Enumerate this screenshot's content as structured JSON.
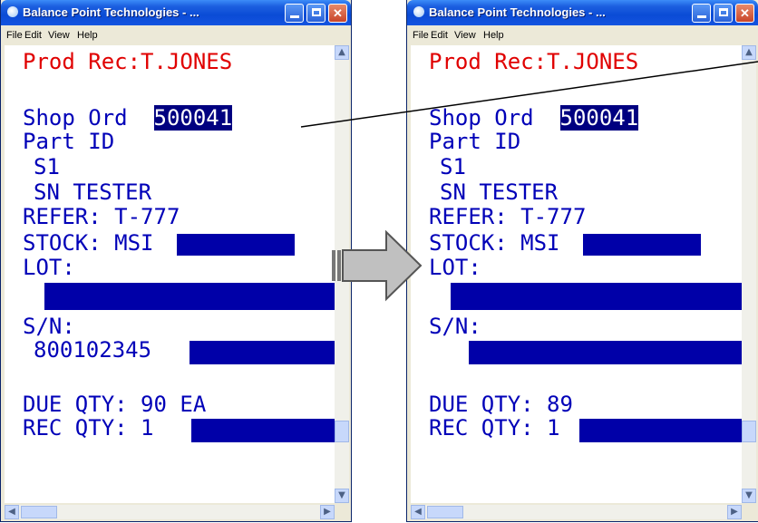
{
  "window_title": "Balance Point Technologies - ...",
  "menu": [
    "File",
    "Edit",
    "View",
    "Help"
  ],
  "before": {
    "header_label": "Prod Rec:",
    "header_user": "T.JONES",
    "shop_ord_label": "Shop Ord",
    "shop_ord_value": "500041",
    "part_id_label": "Part ID",
    "part_id": "S1",
    "part_desc": "SN TESTER",
    "refer": "REFER: T-777",
    "stock": "STOCK: MSI",
    "lot_label": "LOT:",
    "sn_label": "S/N:",
    "sn_value": "800102345",
    "due_qty": "DUE QTY: 90 EA",
    "rec_qty": "REC QTY: 1"
  },
  "after": {
    "header_label": "Prod Rec:",
    "header_user": "T.JONES",
    "shop_ord_label": "Shop Ord",
    "shop_ord_value": "500041",
    "part_id_label": "Part ID",
    "part_id": "S1",
    "part_desc": "SN TESTER",
    "refer": "REFER: T-777",
    "stock": "STOCK: MSI",
    "lot_label": "LOT:",
    "sn_label": "S/N:",
    "sn_value": "",
    "due_qty": "DUE QTY:  89",
    "rec_qty": "REC QTY: 1"
  },
  "colors": {
    "header_text": "#e00000",
    "body_text": "#0000b8",
    "field_fill": "#0000a8",
    "highlight": "#000080"
  }
}
